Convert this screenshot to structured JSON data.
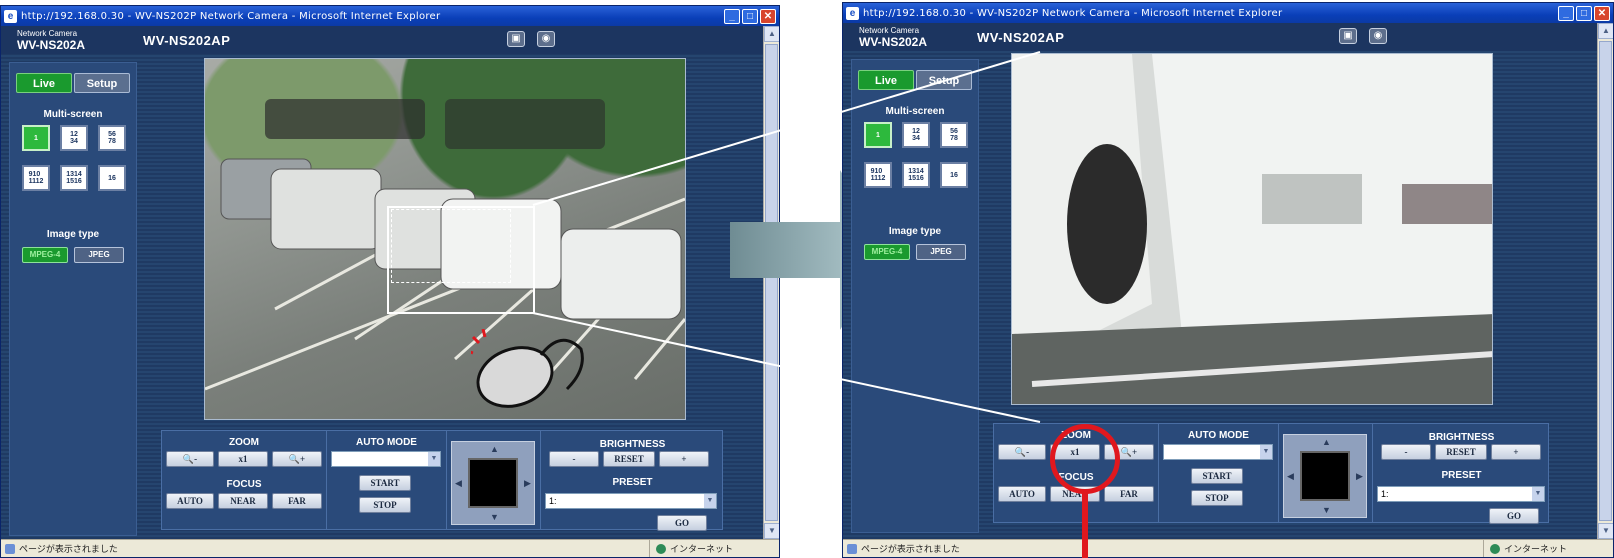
{
  "left_window": {
    "title": "http://192.168.0.30 - WV-NS202P Network Camera - Microsoft Internet Explorer",
    "brand_small": "Network Camera",
    "brand": "WV-NS202A",
    "model": "WV-NS202AP",
    "tabs": {
      "live": "Live",
      "setup": "Setup"
    },
    "multiscreen_label": "Multi-screen",
    "multiscreen_buttons": [
      "1",
      "1 2 3 4",
      "5 6 7 8",
      "9 10 11 12",
      "13 14 15 16",
      "16"
    ],
    "image_type_label": "Image type",
    "image_types": {
      "mpeg4": "MPEG-4",
      "jpeg": "JPEG"
    },
    "zoom": {
      "label": "ZOOM",
      "out": "🔍-",
      "x1": "x1",
      "in": "🔍+"
    },
    "focus": {
      "label": "FOCUS",
      "auto": "AUTO",
      "near": "NEAR",
      "far": "FAR"
    },
    "auto_mode": {
      "label": "AUTO MODE",
      "value": "",
      "start": "START",
      "stop": "STOP"
    },
    "brightness": {
      "label": "BRIGHTNESS",
      "minus": "-",
      "reset": "RESET",
      "plus": "+"
    },
    "preset": {
      "label": "PRESET",
      "value": "1:",
      "go": "GO"
    },
    "status": {
      "text": "ページが表示されました",
      "zone": "インターネット"
    }
  },
  "right_window": {
    "title": "http://192.168.0.30 - WV-NS202P Network Camera - Microsoft Internet Explorer",
    "brand_small": "Network Camera",
    "brand": "WV-NS202A",
    "model": "WV-NS202AP",
    "tabs": {
      "live": "Live",
      "setup": "Setup"
    },
    "multiscreen_label": "Multi-screen",
    "image_type_label": "Image type",
    "image_types": {
      "mpeg4": "MPEG-4",
      "jpeg": "JPEG"
    },
    "zoom": {
      "label": "ZOOM",
      "x1": "x1"
    },
    "focus": {
      "label": "FOCUS",
      "auto": "AUTO",
      "near": "NEAR",
      "far": "FAR"
    },
    "auto_mode": {
      "label": "AUTO MODE",
      "value": "",
      "start": "START",
      "stop": "STOP"
    },
    "brightness": {
      "label": "BRIGHTNESS",
      "minus": "-",
      "reset": "RESET",
      "plus": "+"
    },
    "preset": {
      "label": "PRESET",
      "value": "1:",
      "go": "GO"
    },
    "status": {
      "text": "ページが表示されました",
      "zone": "インターネット"
    }
  },
  "colors": {
    "accent_red": "#e0181e",
    "live_green": "#1a9a2e",
    "panel_blue": "#2a4a7a"
  }
}
